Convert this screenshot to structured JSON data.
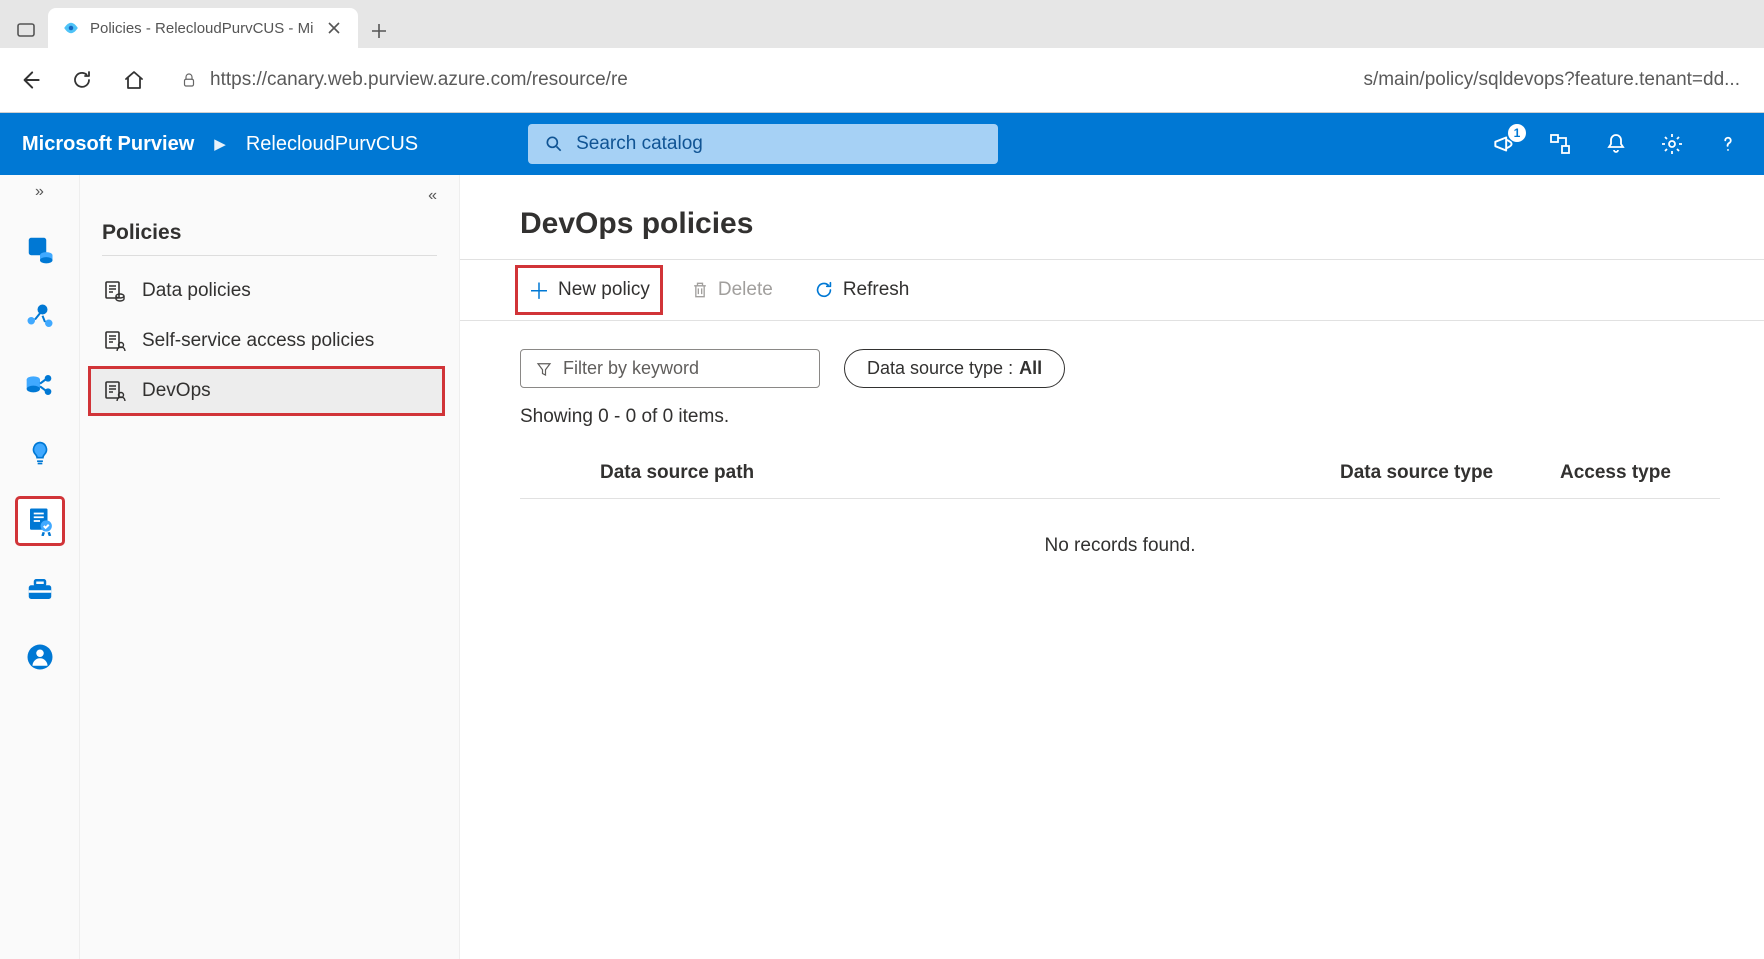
{
  "browser": {
    "tab_title": "Policies - RelecloudPurvCUS - Mi",
    "url_left": "https://canary.web.purview.azure.com/resource/re",
    "url_right": "s/main/policy/sqldevops?feature.tenant=dd..."
  },
  "header": {
    "brand": "Microsoft Purview",
    "workspace": "RelecloudPurvCUS",
    "search_placeholder": "Search catalog",
    "notification_badge": "1"
  },
  "side": {
    "title": "Policies",
    "items": [
      {
        "label": "Data policies"
      },
      {
        "label": "Self-service access policies"
      },
      {
        "label": "DevOps"
      }
    ]
  },
  "main": {
    "title": "DevOps policies",
    "actions": {
      "new": "New policy",
      "delete": "Delete",
      "refresh": "Refresh"
    },
    "filter_placeholder": "Filter by keyword",
    "pill_label": "Data source type :",
    "pill_value": "All",
    "count_text": "Showing 0 - 0 of 0 items.",
    "columns": {
      "path": "Data source path",
      "type": "Data source type",
      "access": "Access type"
    },
    "empty": "No records found."
  }
}
